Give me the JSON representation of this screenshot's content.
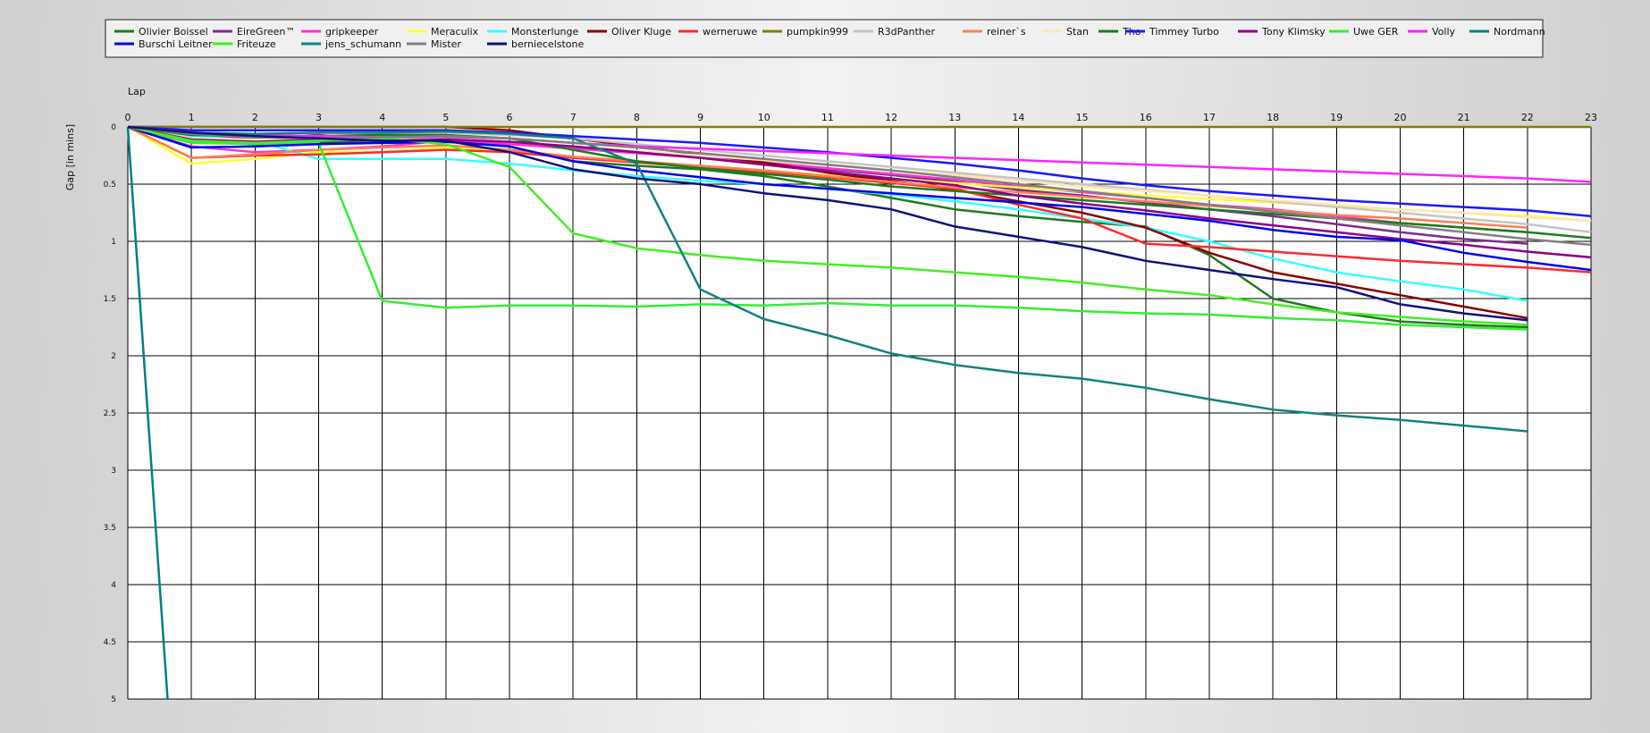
{
  "chart_data": {
    "type": "line",
    "xlabel": "Lap",
    "ylabel": "Gap [in mins]",
    "xlim": [
      0,
      23
    ],
    "ylim": [
      0,
      5
    ],
    "y_inverted": true,
    "grid": true,
    "legend_position": "top",
    "x_ticks": [
      0,
      1,
      2,
      3,
      4,
      5,
      6,
      7,
      8,
      9,
      10,
      11,
      12,
      13,
      14,
      15,
      16,
      17,
      18,
      19,
      20,
      21,
      22,
      23
    ],
    "y_ticks": [
      "0",
      "0.5",
      "1",
      "1.5",
      "2",
      "2.5",
      "3",
      "3.5",
      "4",
      "4.5",
      "5"
    ],
    "x": [
      0,
      1,
      2,
      3,
      4,
      5,
      6,
      7,
      8,
      9,
      10,
      11,
      12,
      13,
      14,
      15,
      16,
      17,
      18,
      19,
      20,
      21,
      22,
      23
    ],
    "series": [
      {
        "name": "Olivier Boissel",
        "color": "#207a20",
        "values": [
          0,
          0.12,
          0.14,
          0.13,
          0.14,
          0.13,
          0.17,
          0.3,
          0.34,
          0.37,
          0.43,
          0.52,
          0.62,
          0.72,
          0.78,
          0.83,
          0.87,
          1.12,
          1.5,
          1.62,
          1.7,
          1.73,
          1.75,
          null
        ]
      },
      {
        "name": "EireGreen™",
        "color": "#7b2d8f",
        "values": [
          0,
          0.08,
          0.1,
          0.07,
          0.12,
          0.1,
          0.13,
          0.18,
          0.22,
          0.27,
          0.32,
          0.37,
          0.42,
          0.48,
          0.55,
          0.6,
          0.66,
          0.72,
          0.78,
          0.85,
          0.92,
          0.98,
          1.02,
          null
        ]
      },
      {
        "name": "gripkeeper",
        "color": "#ff33cc",
        "values": [
          0,
          0.17,
          0.22,
          0.2,
          0.17,
          0.12,
          0.15,
          0.19,
          0.23,
          0.27,
          0.31,
          0.36,
          0.41,
          0.46,
          0.52,
          0.57,
          0.62,
          0.68,
          0.72,
          0.78,
          0.84,
          0.88,
          0.92,
          null
        ]
      },
      {
        "name": "Meraculix",
        "color": "#ffff33",
        "values": [
          0,
          0.32,
          0.28,
          0.22,
          0.22,
          0.18,
          0.22,
          0.27,
          0.31,
          0.34,
          0.38,
          0.42,
          0.45,
          0.49,
          0.53,
          0.56,
          0.6,
          0.63,
          0.66,
          0.69,
          0.72,
          0.75,
          0.78,
          0.82
        ]
      },
      {
        "name": "Monsterlunge",
        "color": "#33ffff",
        "values": [
          0,
          0.08,
          0.12,
          0.28,
          0.28,
          0.28,
          0.32,
          0.38,
          0.43,
          0.47,
          0.5,
          0.54,
          0.59,
          0.65,
          0.72,
          0.8,
          0.88,
          1.0,
          1.15,
          1.27,
          1.35,
          1.42,
          1.52,
          null
        ]
      },
      {
        "name": "Oliver Kluge",
        "color": "#8b0000",
        "values": [
          0,
          0,
          0,
          0,
          0,
          0,
          0.03,
          0.1,
          0.17,
          0.24,
          0.31,
          0.4,
          0.47,
          0.55,
          0.65,
          0.75,
          0.88,
          1.1,
          1.27,
          1.37,
          1.47,
          1.57,
          1.67,
          null
        ]
      },
      {
        "name": "werneruwe",
        "color": "#ff2a2a",
        "values": [
          0,
          0.27,
          0.25,
          0.24,
          0.22,
          0.2,
          0.22,
          0.27,
          0.31,
          0.35,
          0.39,
          0.44,
          0.49,
          0.54,
          0.68,
          0.8,
          1.02,
          1.05,
          1.09,
          1.13,
          1.17,
          1.2,
          1.23,
          1.27
        ]
      },
      {
        "name": "pumpkin999",
        "color": "#808000",
        "values": [
          0,
          0,
          0,
          0,
          0,
          0,
          0,
          0,
          0,
          0,
          0,
          0,
          0,
          0,
          0,
          0,
          0,
          0,
          0,
          0,
          0,
          0,
          0,
          0
        ]
      },
      {
        "name": "R3dPanther",
        "color": "#c4c4c4",
        "values": [
          0,
          0.05,
          0.06,
          0.05,
          0.06,
          0.05,
          0.07,
          0.1,
          0.15,
          0.2,
          0.25,
          0.3,
          0.35,
          0.4,
          0.45,
          0.5,
          0.55,
          0.6,
          0.65,
          0.7,
          0.75,
          0.8,
          0.85,
          0.92
        ]
      },
      {
        "name": "reiner`s",
        "color": "#ff7f50",
        "values": [
          0,
          0.27,
          0.24,
          0.2,
          0.18,
          0.16,
          0.2,
          0.26,
          0.3,
          0.34,
          0.38,
          0.43,
          0.48,
          0.53,
          0.57,
          0.61,
          0.65,
          0.69,
          0.73,
          0.77,
          0.8,
          0.84,
          0.88,
          null
        ]
      },
      {
        "name": "Stan",
        "color": "#ffe4b5",
        "values": [
          0,
          0.1,
          0.11,
          0.1,
          0.1,
          0.1,
          0.13,
          0.17,
          0.21,
          0.25,
          0.29,
          0.33,
          0.38,
          0.42,
          0.47,
          0.52,
          0.56,
          0.6,
          0.64,
          0.68,
          0.72,
          0.75,
          0.79,
          0.82
        ]
      },
      {
        "name": "Tho",
        "color": "#1e7b1e",
        "values": [
          0,
          0.07,
          0.08,
          0.08,
          0.07,
          0.07,
          0.1,
          0.2,
          0.3,
          0.36,
          0.41,
          0.46,
          0.52,
          0.56,
          0.6,
          0.64,
          0.68,
          0.72,
          0.76,
          0.8,
          0.84,
          0.88,
          0.92,
          0.97
        ]
      },
      {
        "name": "Timmey Turbo",
        "color": "#1a1aff",
        "values": [
          0,
          0.03,
          0.03,
          0.03,
          0.03,
          0.03,
          0.05,
          0.08,
          0.11,
          0.14,
          0.18,
          0.22,
          0.27,
          0.32,
          0.38,
          0.45,
          0.51,
          0.56,
          0.6,
          0.64,
          0.67,
          0.7,
          0.73,
          0.78
        ]
      },
      {
        "name": "Tony Klimsky",
        "color": "#8b008b",
        "values": [
          0,
          0.11,
          0.13,
          0.11,
          0.12,
          0.11,
          0.13,
          0.17,
          0.22,
          0.27,
          0.33,
          0.39,
          0.45,
          0.51,
          0.6,
          0.67,
          0.73,
          0.8,
          0.86,
          0.92,
          0.98,
          1.03,
          1.09,
          1.14
        ]
      },
      {
        "name": "Uwe GER",
        "color": "#33ee33",
        "values": [
          0,
          0.14,
          0.15,
          0.14,
          1.52,
          1.58,
          1.56,
          1.56,
          1.57,
          1.55,
          1.56,
          1.54,
          1.56,
          1.56,
          1.58,
          1.61,
          1.63,
          1.64,
          1.67,
          1.69,
          1.73,
          1.75,
          1.77,
          null
        ]
      },
      {
        "name": "Volly",
        "color": "#ff22ff",
        "values": [
          0,
          0.05,
          0.07,
          0.08,
          0.09,
          0.09,
          0.1,
          0.14,
          0.17,
          0.19,
          0.21,
          0.23,
          0.25,
          0.27,
          0.29,
          0.31,
          0.33,
          0.35,
          0.37,
          0.39,
          0.41,
          0.43,
          0.45,
          0.48
        ]
      },
      {
        "name": "Nordmann",
        "color": "#008080",
        "values": [
          0,
          8.0,
          null,
          null,
          null,
          null,
          null,
          null,
          null,
          null,
          null,
          null,
          null,
          null,
          null,
          null,
          null,
          null,
          null,
          null,
          null,
          null,
          null,
          null
        ]
      },
      {
        "name": "Burschi Leitner",
        "color": "#0000ee",
        "values": [
          0,
          0.18,
          0.17,
          0.15,
          0.14,
          0.13,
          0.17,
          0.3,
          0.38,
          0.44,
          0.5,
          0.54,
          0.58,
          0.62,
          0.66,
          0.7,
          0.76,
          0.82,
          0.9,
          0.96,
          0.99,
          1.1,
          1.18,
          1.25
        ]
      },
      {
        "name": "Friteuze",
        "color": "#44ee22",
        "values": [
          0,
          0.12,
          0.14,
          0.12,
          0.1,
          0.15,
          0.35,
          0.93,
          1.06,
          1.12,
          1.17,
          1.2,
          1.23,
          1.27,
          1.31,
          1.36,
          1.42,
          1.47,
          1.55,
          1.62,
          1.66,
          1.7,
          1.73,
          null
        ]
      },
      {
        "name": "jens_schumann",
        "color": "#138080",
        "values": [
          0,
          0.05,
          0.06,
          0.05,
          0.05,
          0.04,
          0.06,
          0.1,
          0.32,
          1.42,
          1.68,
          1.82,
          1.98,
          2.08,
          2.15,
          2.2,
          2.28,
          2.38,
          2.47,
          2.52,
          2.56,
          2.61,
          2.66,
          null
        ]
      },
      {
        "name": "Mister",
        "color": "#808080",
        "values": [
          0,
          0.06,
          0.09,
          0.1,
          0.09,
          0.08,
          0.1,
          0.14,
          0.18,
          0.23,
          0.28,
          0.33,
          0.38,
          0.44,
          0.5,
          0.56,
          0.62,
          0.68,
          0.74,
          0.8,
          0.86,
          0.92,
          0.98,
          1.03
        ]
      },
      {
        "name": "berniecelstone",
        "color": "#101080",
        "values": [
          0,
          0.05,
          0.08,
          0.1,
          0.12,
          0.12,
          0.22,
          0.37,
          0.45,
          0.5,
          0.58,
          0.64,
          0.72,
          0.87,
          0.96,
          1.05,
          1.17,
          1.25,
          1.33,
          1.4,
          1.55,
          1.63,
          1.69,
          null
        ]
      }
    ]
  }
}
